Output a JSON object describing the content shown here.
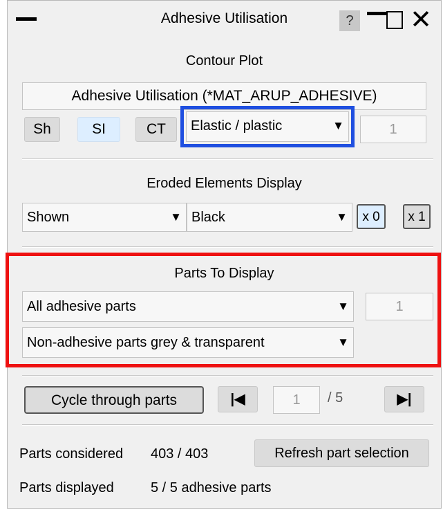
{
  "window": {
    "title": "Adhesive Utilisation",
    "help_label": "?"
  },
  "contour": {
    "section_title": "Contour Plot",
    "plot_label": "Adhesive Utilisation (*MAT_ARUP_ADHESIVE)",
    "sh_label": "Sh",
    "si_label": "SI",
    "ct_label": "CT",
    "mode_value": "Elastic / plastic",
    "mode_number": "1"
  },
  "eroded": {
    "section_title": "Eroded Elements Display",
    "display_value": "Shown",
    "colour_value": "Black",
    "x0_label": "x 0",
    "x1_label": "x 1"
  },
  "parts": {
    "section_title": "Parts To Display",
    "selection_value": "All adhesive parts",
    "selection_number": "1",
    "non_adhesive_value": "Non-adhesive parts grey & transparent"
  },
  "cycle": {
    "button_label": "Cycle through parts",
    "current": "1",
    "total": "/ 5"
  },
  "status": {
    "considered_label": "Parts considered",
    "considered_value": "403 / 403",
    "refresh_label": "Refresh part selection",
    "displayed_label": "Parts displayed",
    "displayed_value": "5 / 5 adhesive parts"
  },
  "colors": {
    "highlight_blue": "#1f4fe0",
    "highlight_red": "#ee1111",
    "si_button_bg": "#ddeeff",
    "x_buttons_bg": "#ddeeff"
  },
  "icons": {
    "first": "skip-to-first-icon",
    "last": "skip-to-last-icon",
    "dropdown": "triangle-down-icon"
  }
}
